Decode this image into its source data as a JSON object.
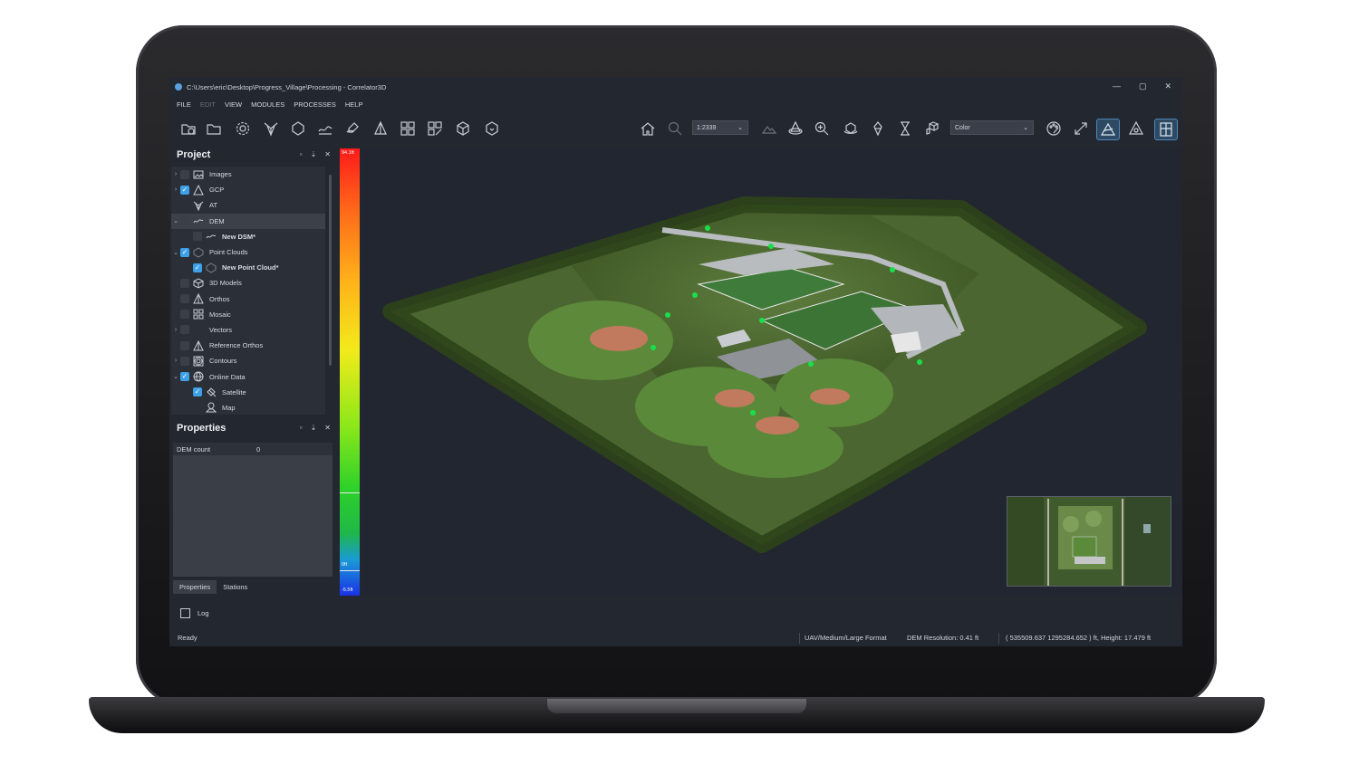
{
  "window": {
    "title": "C:\\Users\\eric\\Desktop\\Progress_Village\\Processing - Correlator3D",
    "controls": {
      "minimize": "—",
      "maximize": "▢",
      "close": "✕"
    }
  },
  "menu": {
    "file": "FILE",
    "edit": "EDIT",
    "view": "VIEW",
    "modules": "MODULES",
    "processes": "PROCESSES",
    "help": "HELP"
  },
  "toolbar": {
    "scale_value": "1:2339",
    "render_mode": "Color"
  },
  "project_panel": {
    "title": "Project",
    "items": [
      {
        "label": "Images"
      },
      {
        "label": "GCP"
      },
      {
        "label": "AT"
      },
      {
        "label": "DEM"
      },
      {
        "label": "New DSM*"
      },
      {
        "label": "Point Clouds"
      },
      {
        "label": "New Point Cloud*"
      },
      {
        "label": "3D Models"
      },
      {
        "label": "Orthos"
      },
      {
        "label": "Mosaic"
      },
      {
        "label": "Vectors"
      },
      {
        "label": "Reference Orthos"
      },
      {
        "label": "Contours"
      },
      {
        "label": "Online Data"
      },
      {
        "label": "Satellite"
      },
      {
        "label": "Map"
      }
    ]
  },
  "properties_panel": {
    "title": "Properties",
    "rows": [
      {
        "key": "DEM count",
        "value": "0"
      }
    ],
    "tabs": [
      "Properties",
      "Stations"
    ]
  },
  "color_scale": {
    "max": "94.1ft",
    "zero": "0ft",
    "min": "-5.5ft",
    "colors": {
      "high": "#ff1a1a",
      "mid": "#f2ea1a",
      "low": "#1a30e6"
    }
  },
  "log": {
    "label": "Log"
  },
  "status": {
    "state": "Ready",
    "format": "UAV/Medium/Large Format",
    "dem_resolution": "DEM Resolution: 0.41 ft",
    "coordinates": "( 535509.637 1295284.652 ) ft, Height: 17.479 ft"
  },
  "colors": {
    "accent": "#3ea0e6",
    "marker": "#19e04a",
    "background": "#232730"
  }
}
